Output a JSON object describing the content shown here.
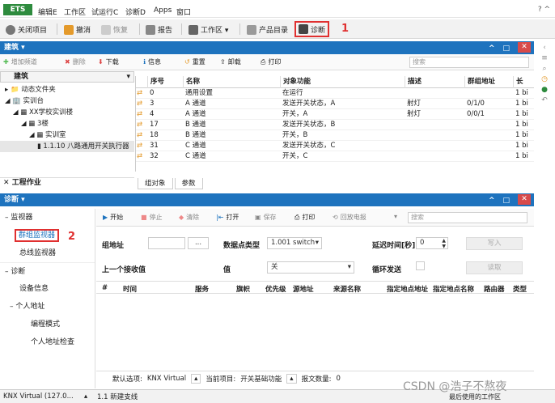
{
  "menubar": {
    "logo": "ETS",
    "items": [
      "编辑E",
      "工作区",
      "试运行C",
      "诊断D",
      "Apps",
      "窗口"
    ],
    "right": "?  ^"
  },
  "toolbar": {
    "close_project": "关闭项目",
    "undo": "撤消",
    "redo": "恢复",
    "report": "报告",
    "workspace": "工作区 ▾",
    "catalog": "产品目录",
    "diagnostics": "诊断",
    "annot1": "1"
  },
  "build": {
    "title": "建筑 ▾",
    "tools": {
      "add": "增加频道",
      "delete": "删除",
      "download": "下载",
      "info": "信息",
      "reset": "重置",
      "unload": "卸载",
      "print": "打印"
    },
    "search_placeholder": "搜索",
    "tree_root": "建筑",
    "tree": [
      "动态文件夹",
      "实训台",
      "XX学校实训楼",
      "3楼",
      "实训室",
      "1.1.10 八路通用开关执行器"
    ],
    "work_area": "工程作业",
    "columns": [
      "序号",
      "名称",
      "对象功能",
      "描述",
      "群组地址",
      "长"
    ],
    "rows": [
      [
        "0",
        "通用设置",
        "在运行",
        "",
        "",
        "1 bi"
      ],
      [
        "3",
        "A 通道",
        "发送开关状态，A",
        "射灯",
        "0/1/0",
        "1 bi"
      ],
      [
        "4",
        "A 通道",
        "开关，A",
        "射灯",
        "0/0/1",
        "1 bi"
      ],
      [
        "17",
        "B 通道",
        "发送开关状态，B",
        "",
        "",
        "1 bi"
      ],
      [
        "18",
        "B 通道",
        "开关，B",
        "",
        "",
        "1 bi"
      ],
      [
        "31",
        "C 通道",
        "发送开关状态，C",
        "",
        "",
        "1 bi"
      ],
      [
        "32",
        "C 通道",
        "开关，C",
        "",
        "",
        "1 bi"
      ]
    ],
    "tabs": [
      "组对象",
      "参数"
    ]
  },
  "diag": {
    "title": "诊断 ▾",
    "side": {
      "monitor": "监视器",
      "group_monitor": "群组监视器",
      "bus_monitor": "总线监视器",
      "diagnostic": "诊断",
      "device_info": "设备信息",
      "individual": "个人地址",
      "prog_mode": "编程模式",
      "addr_check": "个人地址检查",
      "annot2": "2"
    },
    "toolbar": {
      "start": "开始",
      "stop": "停止",
      "clear": "清除",
      "open": "打开",
      "save": "保存",
      "print": "打印",
      "replay": "回放电报",
      "search": "搜索"
    },
    "form": {
      "group_addr": "组地址",
      "dpt_label": "数据点类型",
      "dpt_value": "1.001 switch",
      "delay_label": "延迟时间[秒]",
      "delay_value": "0",
      "write": "写入",
      "last_value": "上一个接收值",
      "value_label": "值",
      "value_value": "关",
      "loop": "循环发送",
      "read": "读取",
      "browse": "..."
    },
    "columns": [
      "#",
      "时间",
      "服务",
      "旗帜",
      "优先级",
      "源地址",
      "来源名称",
      "指定地点地址",
      "指定地点名称",
      "路由器",
      "类型"
    ],
    "status": {
      "default_label": "默认选项:",
      "default_value": "KNX Virtual",
      "current_label": "当前项目:",
      "current_value": "开关基础功能",
      "count_label": "报文数量:",
      "count_value": "0"
    }
  },
  "statusbar": {
    "left": "KNX Virtual (127.0...",
    "mid": "1.1 新建支线",
    "right": "最后使用的工作区",
    "watermark": "CSDN @浩子不熬夜"
  },
  "colors": {
    "accent": "#1e73be",
    "ets_green": "#2e8b3e",
    "highlight": "#e03030"
  }
}
